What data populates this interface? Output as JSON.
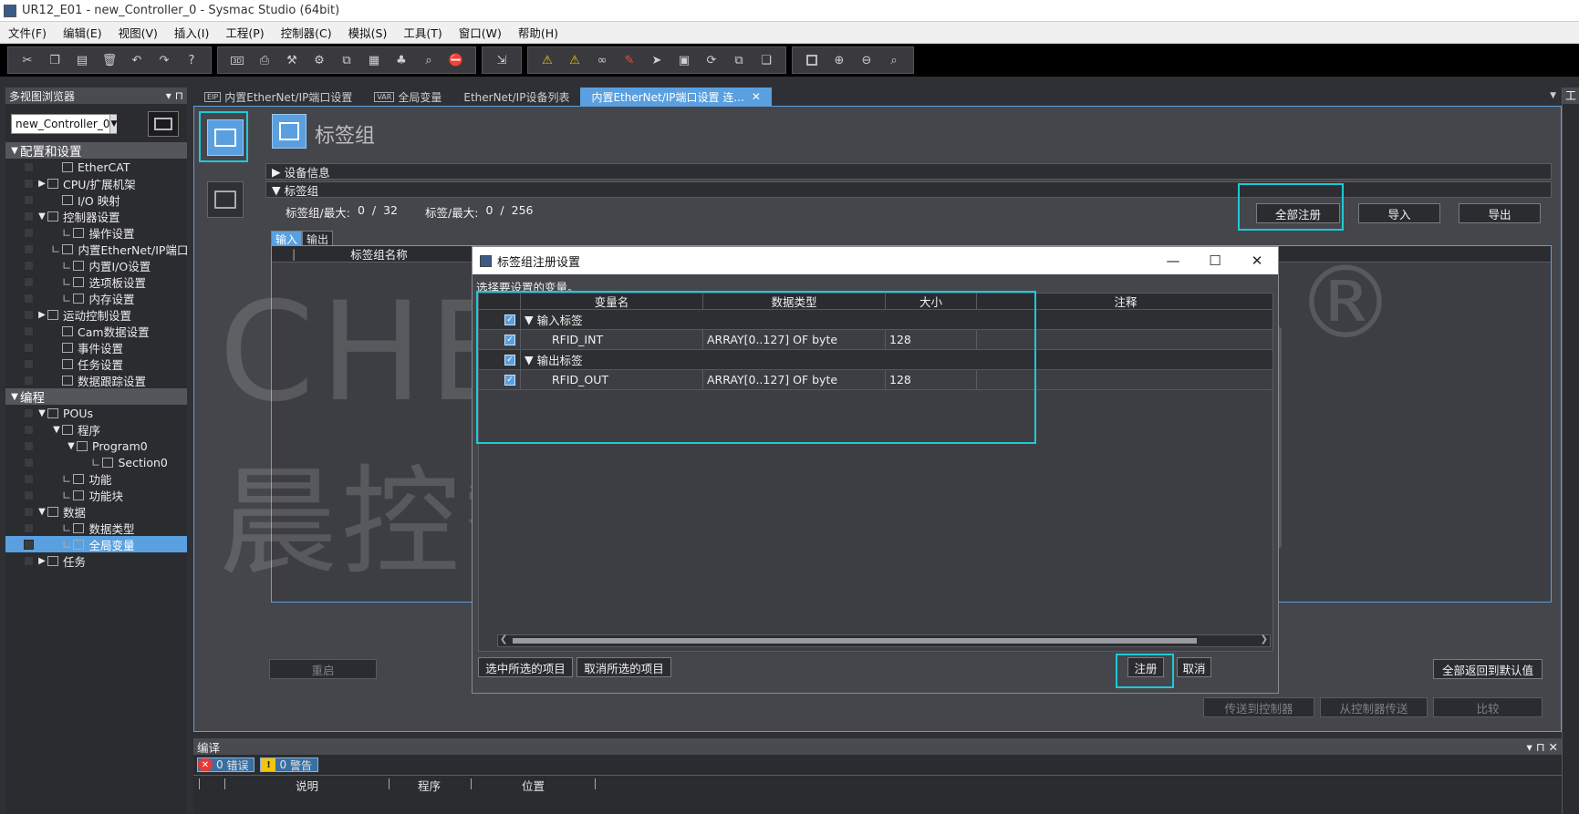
{
  "window": {
    "title": "UR12_E01 - new_Controller_0 - Sysmac Studio (64bit)"
  },
  "menu": [
    "文件(F)",
    "编辑(E)",
    "视图(V)",
    "插入(I)",
    "工程(P)",
    "控制器(C)",
    "模拟(S)",
    "工具(T)",
    "窗口(W)",
    "帮助(H)"
  ],
  "left_panel": {
    "title": "多视图浏览器",
    "pin_glyph": "▾ ⊓",
    "controller": "new_Controller_0",
    "tree": [
      {
        "label": "配置和设置",
        "section": true,
        "twisty": "▼",
        "level": 0
      },
      {
        "label": "EtherCAT",
        "level": 2
      },
      {
        "label": "CPU/扩展机架",
        "level": 1,
        "twisty": "▶"
      },
      {
        "label": "I/O 映射",
        "level": 2
      },
      {
        "label": "控制器设置",
        "level": 1,
        "twisty": "▼"
      },
      {
        "label": "操作设置",
        "level": 2,
        "leaf": true
      },
      {
        "label": "内置EtherNet/IP端口",
        "level": 2,
        "leaf": true
      },
      {
        "label": "内置I/O设置",
        "level": 2,
        "leaf": true
      },
      {
        "label": "选项板设置",
        "level": 2,
        "leaf": true
      },
      {
        "label": "内存设置",
        "level": 2,
        "leaf": true
      },
      {
        "label": "运动控制设置",
        "level": 1,
        "twisty": "▶"
      },
      {
        "label": "Cam数据设置",
        "level": 2
      },
      {
        "label": "事件设置",
        "level": 2
      },
      {
        "label": "任务设置",
        "level": 2
      },
      {
        "label": "数据跟踪设置",
        "level": 2
      },
      {
        "label": "编程",
        "section": true,
        "twisty": "▼",
        "level": 0
      },
      {
        "label": "POUs",
        "level": 1,
        "twisty": "▼"
      },
      {
        "label": "程序",
        "level": 2,
        "twisty": "▼"
      },
      {
        "label": "Program0",
        "level": 3,
        "twisty": "▼"
      },
      {
        "label": "Section0",
        "level": 4,
        "leaf": true
      },
      {
        "label": "功能",
        "level": 2,
        "leaf": true
      },
      {
        "label": "功能块",
        "level": 2,
        "leaf": true
      },
      {
        "label": "数据",
        "level": 1,
        "twisty": "▼"
      },
      {
        "label": "数据类型",
        "level": 2,
        "leaf": true
      },
      {
        "label": "全局变量",
        "level": 2,
        "leaf": true,
        "selected": true
      },
      {
        "label": "任务",
        "level": 1,
        "twisty": "▶"
      }
    ]
  },
  "tabs": [
    {
      "label": "内置EtherNet/IP端口设置",
      "badge": "EIP"
    },
    {
      "label": "全局变量",
      "badge": "VAR"
    },
    {
      "label": "EtherNet/IP设备列表",
      "badge": ""
    },
    {
      "label": "内置EtherNet/IP端口设置 连...",
      "badge": "",
      "active": true,
      "close": "✕"
    }
  ],
  "editor": {
    "title": "标签组",
    "sections": {
      "device_info": "设备信息",
      "tag_group": "标签组"
    },
    "summary": {
      "groups_label": "标签组/最大:",
      "groups_value": "0",
      "groups_max": "32",
      "tags_label": "标签/最大:",
      "tags_value": "0",
      "tags_max": "256",
      "sep": "/"
    },
    "buttons": {
      "register_all": "全部注册",
      "import": "导入",
      "export": "导出"
    },
    "io_tabs": {
      "input": "输入",
      "output": "输出"
    },
    "table_header": "标签组名称",
    "bottom": {
      "restart": "重启",
      "reset_all": "全部返回到默认值",
      "send_to": "传送到控制器",
      "recv_from": "从控制器传送",
      "compare": "比较"
    }
  },
  "dialog": {
    "title": "标签组注册设置",
    "window_controls": {
      "min": "—",
      "max": "☐",
      "close": "✕"
    },
    "prompt": "选择要设置的变量。",
    "columns": {
      "name": "变量名",
      "type": "数据类型",
      "size": "大小",
      "comment": "注释"
    },
    "rows": [
      {
        "group": true,
        "name": "输入标签",
        "checked": true
      },
      {
        "group": false,
        "name": "RFID_INT",
        "type": "ARRAY[0..127] OF byte",
        "size": "128",
        "checked": true
      },
      {
        "group": true,
        "name": "输出标签",
        "checked": true
      },
      {
        "group": false,
        "name": "RFID_OUT",
        "type": "ARRAY[0..127] OF byte",
        "size": "128",
        "checked": true
      }
    ],
    "buttons": {
      "select_all": "选中所选的项目",
      "deselect": "取消所选的项目",
      "register": "注册",
      "cancel": "取消"
    }
  },
  "bottom_panel": {
    "title": "编译",
    "errors_count": "0",
    "errors_label": "错误",
    "warnings_count": "0",
    "warnings_label": "警告",
    "cols": {
      "desc": "说明",
      "program": "程序",
      "position": "位置"
    }
  },
  "right_panel": {
    "title": "工"
  },
  "watermark": {
    "latin": "CHENKONG",
    "cn": "晨控智能",
    "reg": "®"
  },
  "colors": {
    "accent": "#5aa0e0",
    "highlight": "#1ec9d6",
    "bg": "#2f3035"
  }
}
